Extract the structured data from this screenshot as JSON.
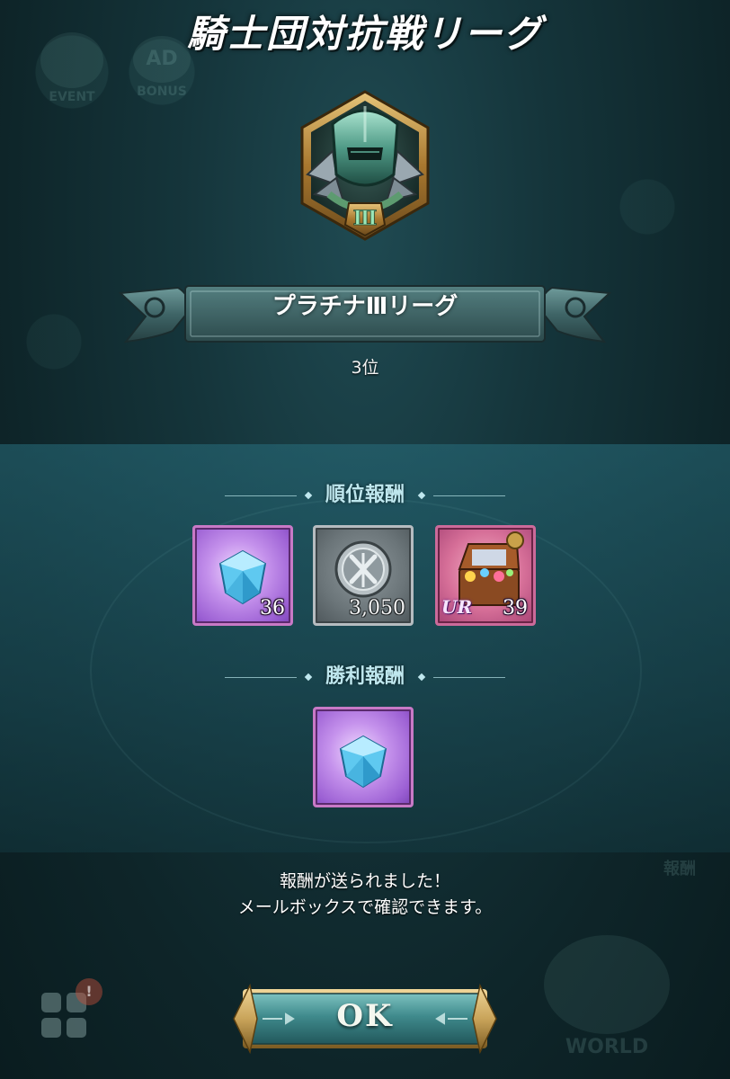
{
  "header": {
    "title": "騎士団対抗戦リーグ",
    "bg_event_label": "EVENT",
    "bg_ad_label": "AD",
    "bg_bonus_label": "BONUS"
  },
  "emblem": {
    "tier_numeral": "Ⅲ",
    "icon": "knight-helmet-icon"
  },
  "league": {
    "name": "プラチナⅢリーグ",
    "rank": "3位"
  },
  "rank_rewards": {
    "heading": "順位報酬",
    "items": [
      {
        "icon": "blue-gem-icon",
        "quantity": "36",
        "frame_color": "#c879c6"
      },
      {
        "icon": "silver-medal-coin-icon",
        "quantity": "3,050",
        "frame_color": "#b6bcc0"
      },
      {
        "icon": "treasure-chest-icon",
        "quantity": "39",
        "badge": "UR",
        "frame_color": "#cc6a9a"
      }
    ]
  },
  "win_rewards": {
    "heading": "勝利報酬",
    "items": [
      {
        "icon": "blue-gem-icon",
        "frame_color": "#c879c6"
      }
    ]
  },
  "message": {
    "line1": "報酬が送られました！",
    "line2": "メールボックスで確認できます。"
  },
  "footer": {
    "ok_label": "OK",
    "bg_world_label": "WORLD",
    "bg_report_label": "報酬"
  },
  "colors": {
    "accent": "#bfe7ee",
    "button_face": "#3f8a8c",
    "gold_frame": "#c9a45a"
  }
}
